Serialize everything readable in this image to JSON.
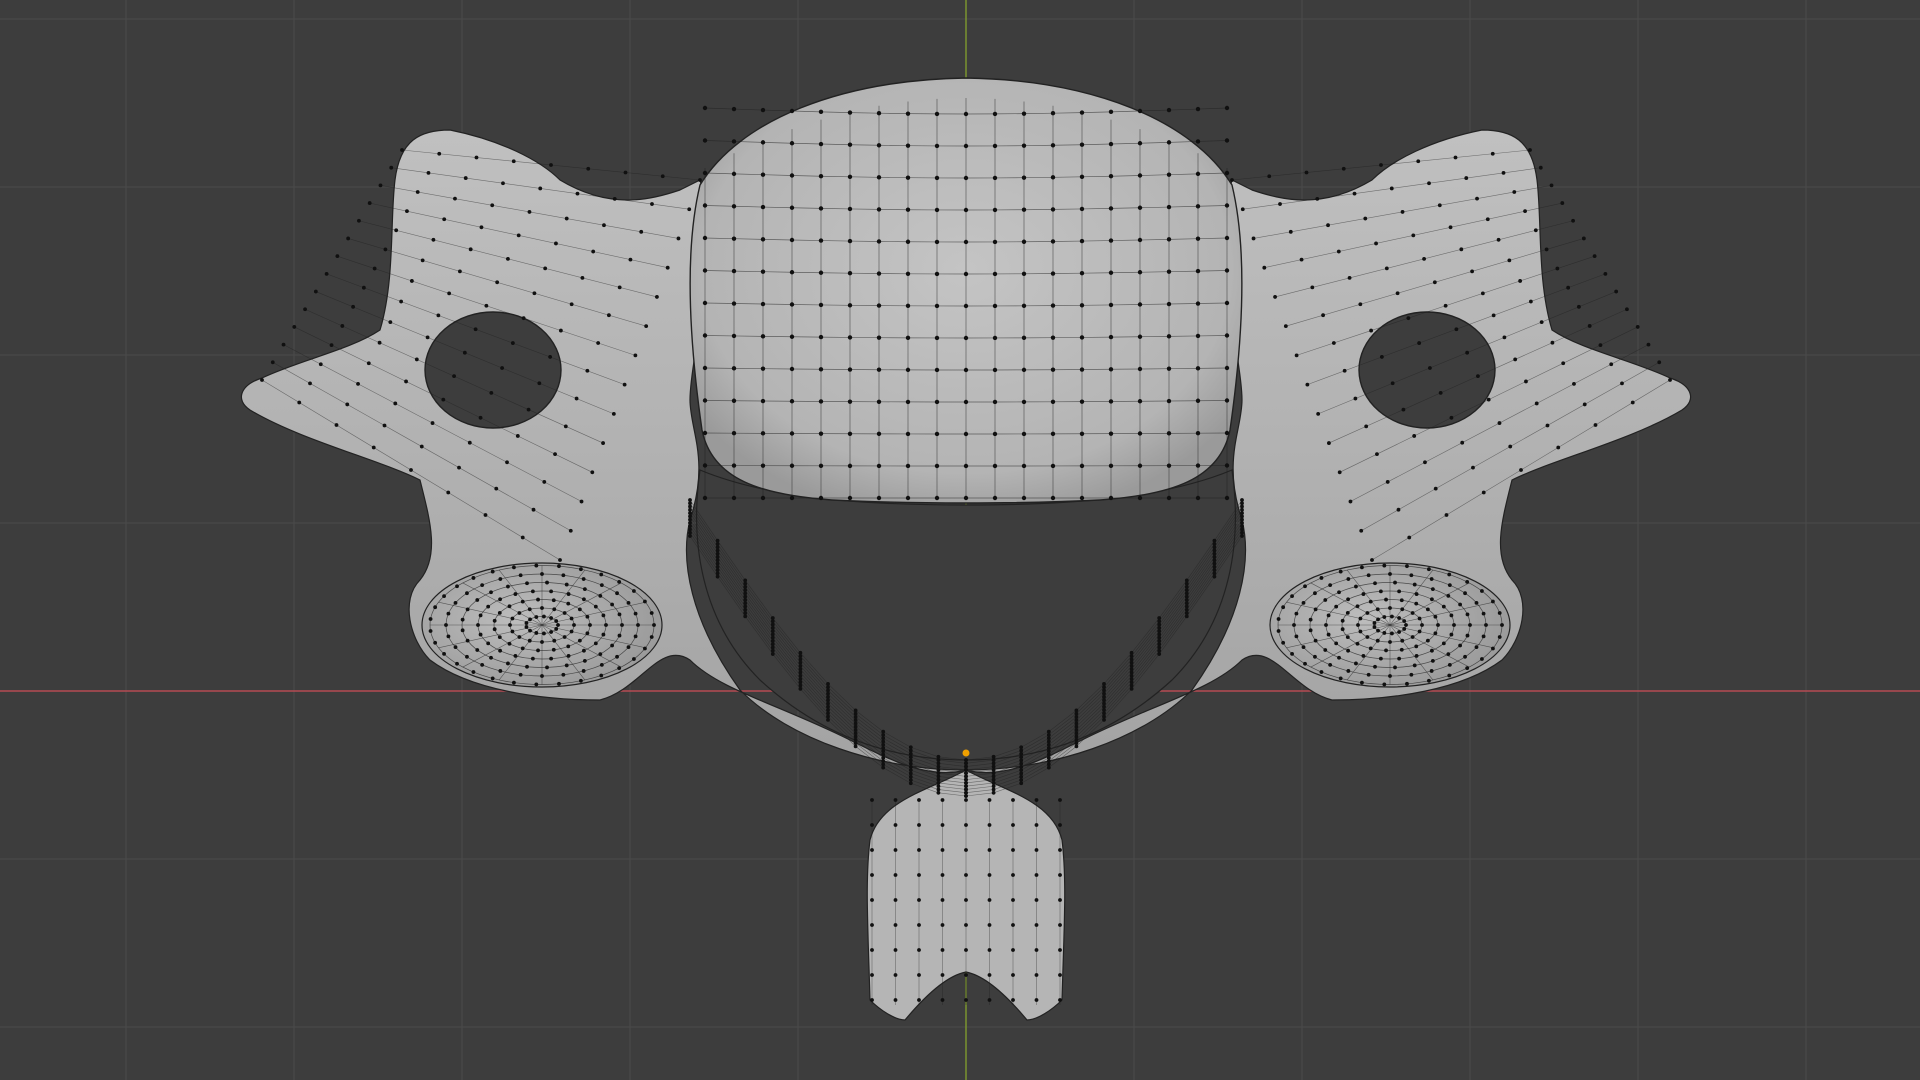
{
  "viewport": {
    "background_color": "#3d3d3d",
    "grid_color": "#4a4a4a",
    "x_axis_color": "#b54b53",
    "y_axis_color": "#7f9a2e",
    "mesh_fill_color": "#b9b9b9",
    "mesh_edge_color": "#1f1f1f",
    "vertex_color": "#101010",
    "origin_color": "#f0a000"
  },
  "mesh": {
    "object": "vertebra",
    "mode": "edit-mode",
    "display": "vertices-and-edges",
    "symmetry": "mirror-x"
  }
}
